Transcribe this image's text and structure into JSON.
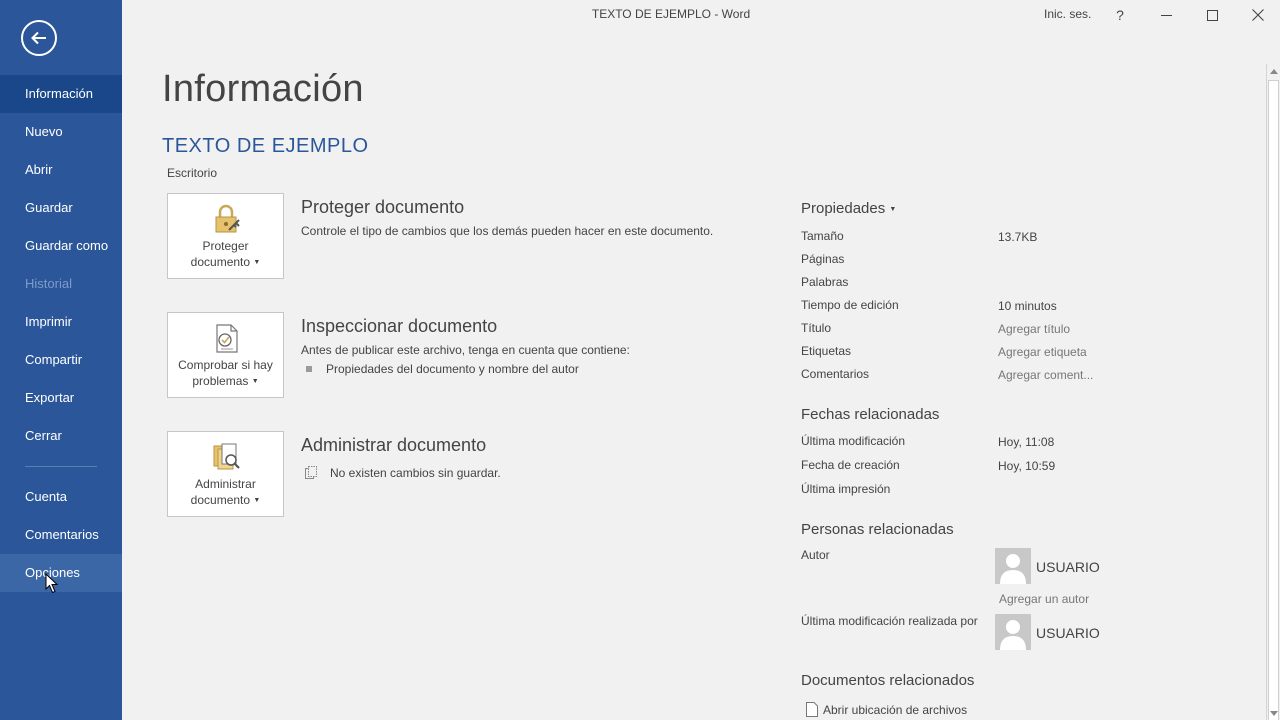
{
  "window": {
    "title": "TEXTO DE EJEMPLO  -  Word",
    "signin": "Inic. ses.",
    "help": "?"
  },
  "sidebar": {
    "items": [
      {
        "label": "Información"
      },
      {
        "label": "Nuevo"
      },
      {
        "label": "Abrir"
      },
      {
        "label": "Guardar"
      },
      {
        "label": "Guardar como"
      },
      {
        "label": "Historial"
      },
      {
        "label": "Imprimir"
      },
      {
        "label": "Compartir"
      },
      {
        "label": "Exportar"
      },
      {
        "label": "Cerrar"
      }
    ],
    "bottom_items": [
      {
        "label": "Cuenta"
      },
      {
        "label": "Comentarios"
      },
      {
        "label": "Opciones"
      }
    ]
  },
  "main": {
    "title": "Información",
    "doc_title": "TEXTO DE EJEMPLO",
    "doc_location": "Escritorio",
    "protect": {
      "tile_line1": "Proteger",
      "tile_line2": "documento",
      "heading": "Proteger documento",
      "text": "Controle el tipo de cambios que los demás pueden hacer en este documento."
    },
    "inspect": {
      "tile_line1": "Comprobar si hay",
      "tile_line2": "problemas",
      "heading": "Inspeccionar documento",
      "text": "Antes de publicar este archivo, tenga en cuenta que contiene:",
      "bullet": "Propiedades del documento y nombre del autor"
    },
    "manage": {
      "tile_line1": "Administrar",
      "tile_line2": "documento",
      "heading": "Administrar documento",
      "text": "No existen cambios sin guardar."
    }
  },
  "properties": {
    "heading": "Propiedades",
    "rows": [
      {
        "label": "Tamaño",
        "value": "13.7KB"
      },
      {
        "label": "Páginas",
        "value": ""
      },
      {
        "label": "Palabras",
        "value": ""
      },
      {
        "label": "Tiempo de edición",
        "value": "10 minutos"
      },
      {
        "label": "Título",
        "value": "Agregar título"
      },
      {
        "label": "Etiquetas",
        "value": "Agregar etiqueta"
      },
      {
        "label": "Comentarios",
        "value": "Agregar coment..."
      }
    ],
    "dates": {
      "heading": "Fechas relacionadas",
      "rows": [
        {
          "label": "Última modificación",
          "value": "Hoy, 11:08"
        },
        {
          "label": "Fecha de creación",
          "value": "Hoy, 10:59"
        },
        {
          "label": "Última impresión",
          "value": ""
        }
      ]
    },
    "people": {
      "heading": "Personas relacionadas",
      "author_label": "Autor",
      "author_name": "USUARIO",
      "add_author": "Agregar un autor",
      "modified_by_label": "Última modificación realizada por",
      "modified_by_name": "USUARIO"
    },
    "related_docs": {
      "heading": "Documentos relacionados",
      "open_location": "Abrir ubicación de archivos"
    }
  }
}
